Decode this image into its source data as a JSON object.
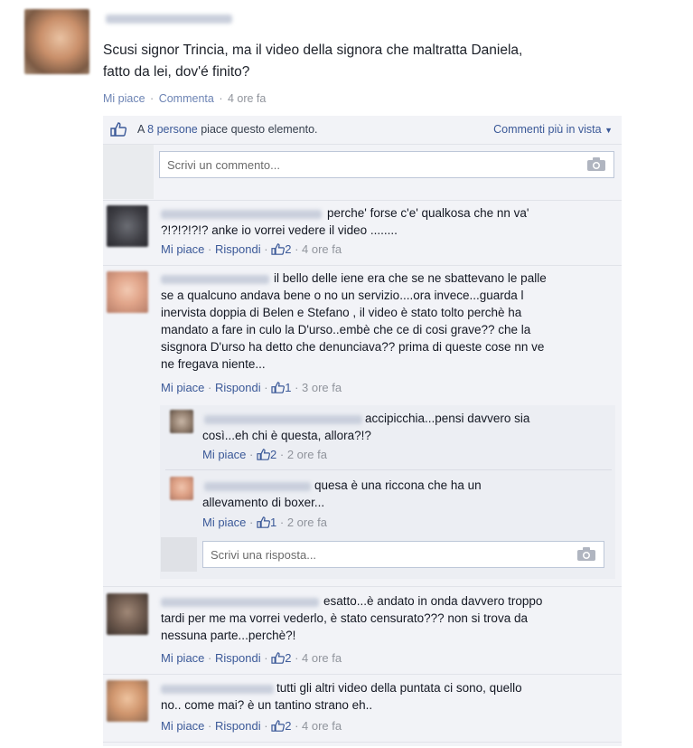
{
  "post": {
    "text_line1": "Scusi signor Trincia, ma il video della signora che maltratta Daniela,",
    "text_line2": "fatto da lei, dov'é finito?",
    "like_link": "Mi piace",
    "comment_link": "Commenta",
    "time": "4 ore fa"
  },
  "likes_bar": {
    "prefix": "A",
    "people": "8 persone",
    "suffix": "piace questo elemento.",
    "sort_label": "Commenti più in vista"
  },
  "comment_input": {
    "placeholder": "Scrivi un commento..."
  },
  "reply_input": {
    "placeholder": "Scrivi una risposta..."
  },
  "comments": [
    {
      "lines": [
        "perche' forse c'e' qualkosa che nn va'",
        "?!?!?!?!? anke io vorrei vedere il video ........"
      ],
      "like": "Mi piace",
      "reply": "Rispondi",
      "likes": "2",
      "time": "4 ore fa"
    },
    {
      "lines": [
        "il bello delle iene era che se ne sbattevano le palle",
        "se a qualcuno andava bene o no un servizio....ora invece...guarda l",
        "inervista doppia di Belen e Stefano , il video è stato tolto perchè ha",
        "mandato a fare in culo la D'urso..embè che ce di cosi grave?? che la",
        "sisgnora D'urso ha detto che denunciava?? prima di queste cose nn ve",
        "ne fregava niente..."
      ],
      "like": "Mi piace",
      "reply": "Rispondi",
      "likes": "1",
      "time": "3 ore fa",
      "replies": [
        {
          "lines": [
            "accipicchia...pensi davvero sia",
            "così...eh chi è questa, allora?!?"
          ],
          "like": "Mi piace",
          "likes": "2",
          "time": "2 ore fa"
        },
        {
          "lines": [
            "quesa è una riccona che ha un",
            "allevamento di boxer..."
          ],
          "like": "Mi piace",
          "likes": "1",
          "time": "2 ore fa"
        }
      ]
    },
    {
      "lines": [
        "esatto...è andato in onda davvero troppo",
        "tardi per me ma vorrei vederlo, è stato censurato??? non si trova da",
        "nessuna parte...perchè?!"
      ],
      "like": "Mi piace",
      "reply": "Rispondi",
      "likes": "2",
      "time": "4 ore fa"
    },
    {
      "lines": [
        "tutti gli altri video della puntata ci sono, quello",
        "no.. come mai? è un tantino strano eh.."
      ],
      "like": "Mi piace",
      "reply": "Rispondi",
      "likes": "2",
      "time": "4 ore fa"
    }
  ],
  "separators": {
    "dot": "·"
  },
  "icons": {
    "like": "thumbs-up-icon",
    "camera": "camera-icon",
    "dropdown": "caret-down-icon"
  },
  "colors": {
    "link": "#3b5998",
    "panel": "#f2f3f7",
    "meta_gray": "#90949c"
  }
}
